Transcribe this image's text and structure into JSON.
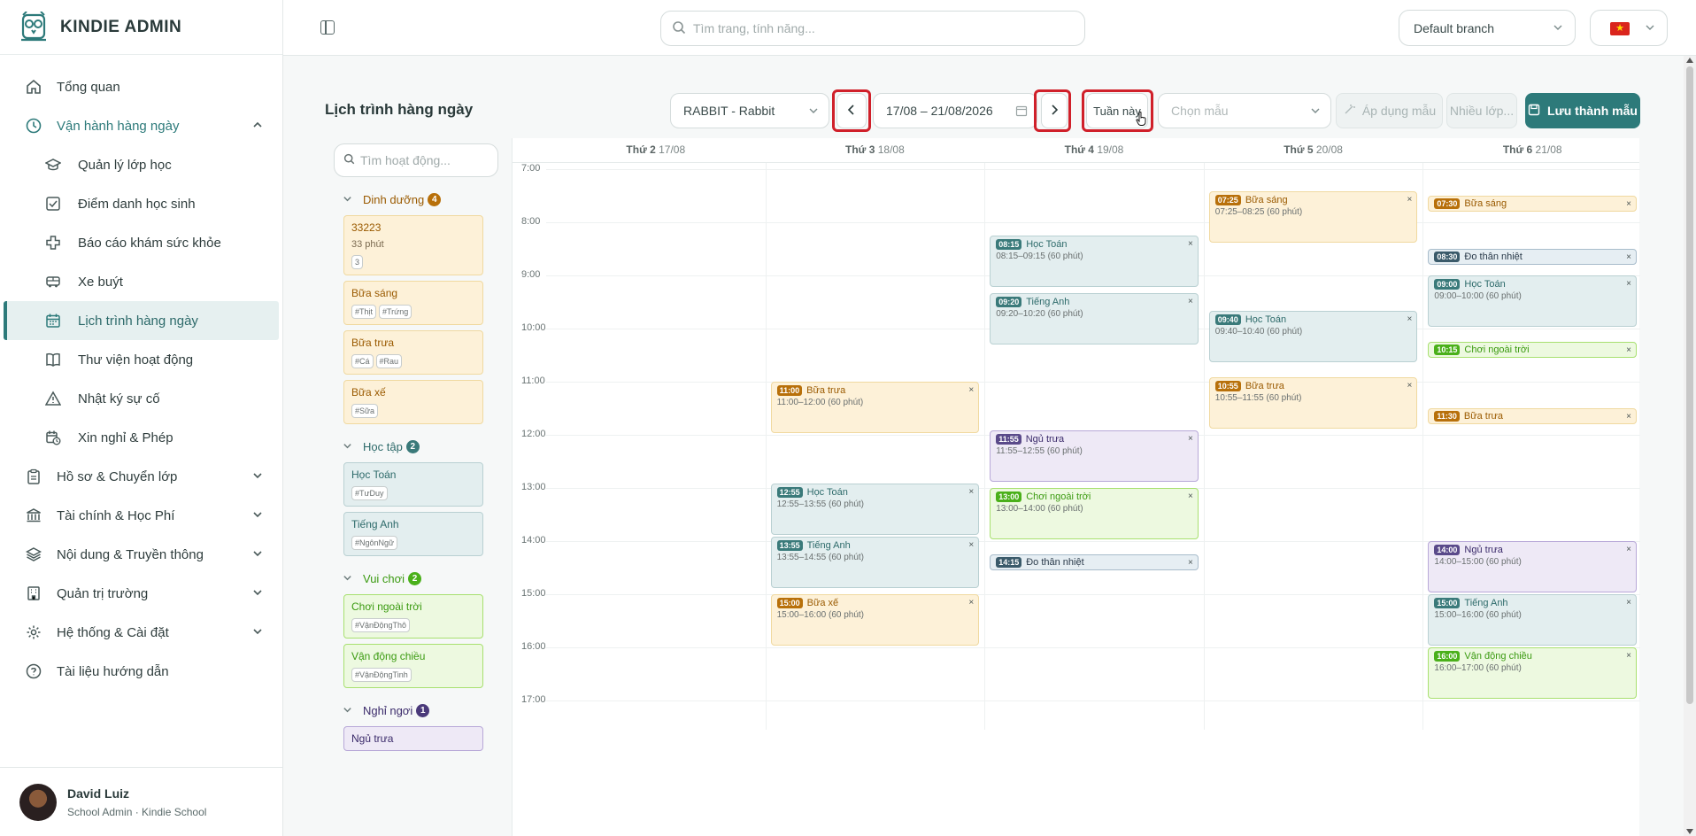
{
  "app": {
    "name": "KINDIE ADMIN"
  },
  "sidebar": {
    "items": [
      {
        "label": "Tổng quan",
        "icon": "home-icon"
      },
      {
        "label": "Vận hành hàng ngày",
        "icon": "clock-icon"
      },
      {
        "label": "Quản lý lớp học",
        "icon": "graduation-cap-icon"
      },
      {
        "label": "Điểm danh học sinh",
        "icon": "checkbox-icon"
      },
      {
        "label": "Báo cáo khám sức khỏe",
        "icon": "health-cross-icon"
      },
      {
        "label": "Xe buýt",
        "icon": "bus-icon"
      },
      {
        "label": "Lịch trình hàng ngày",
        "icon": "calendar-icon"
      },
      {
        "label": "Thư viện hoạt động",
        "icon": "book-icon"
      },
      {
        "label": "Nhật ký sự cố",
        "icon": "warning-icon"
      },
      {
        "label": "Xin nghỉ & Phép",
        "icon": "calendar-clock-icon"
      },
      {
        "label": "Hồ sơ & Chuyển lớp",
        "icon": "clipboard-icon"
      },
      {
        "label": "Tài chính & Học Phí",
        "icon": "bank-icon"
      },
      {
        "label": "Nội dung & Truyền thông",
        "icon": "layers-icon"
      },
      {
        "label": "Quản trị trường",
        "icon": "building-icon"
      },
      {
        "label": "Hệ thống & Cài đặt",
        "icon": "gear-icon"
      },
      {
        "label": "Tài liệu hướng dẫn",
        "icon": "help-icon"
      }
    ]
  },
  "user": {
    "name": "David Luiz",
    "role": "School Admin · Kindie School"
  },
  "topbar": {
    "search_placeholder": "Tìm trang, tính năng...",
    "branch": "Default branch"
  },
  "toolbar": {
    "title": "Lịch trình hàng ngày",
    "class_select": "RABBIT - Rabbit",
    "date_range": "17/08 – 21/08/2026",
    "this_week": "Tuần này",
    "template_placeholder": "Chọn mẫu",
    "apply_template": "Áp dụng mẫu",
    "multi_class": "Nhiều lớp...",
    "save_template": "Lưu thành mẫu"
  },
  "library": {
    "search_placeholder": "Tìm hoạt động...",
    "groups": [
      {
        "name": "Dinh dưỡng",
        "count": "4",
        "color": "#b8700a",
        "items": [
          {
            "title": "33223",
            "sub": "33 phút",
            "tags": [
              "3"
            ]
          },
          {
            "title": "Bữa sáng",
            "tags": [
              "#Thịt",
              "#Trứng"
            ]
          },
          {
            "title": "Bữa trưa",
            "tags": [
              "#Cá",
              "#Rau"
            ]
          },
          {
            "title": "Bữa xế",
            "tags": [
              "#Sữa"
            ]
          }
        ]
      },
      {
        "name": "Học tập",
        "count": "2",
        "color": "#3a7a7a",
        "items": [
          {
            "title": "Học Toán",
            "tags": [
              "#TưDuy"
            ]
          },
          {
            "title": "Tiếng Anh",
            "tags": [
              "#NgônNgữ"
            ]
          }
        ]
      },
      {
        "name": "Vui chơi",
        "count": "2",
        "color": "#4ab01a",
        "items": [
          {
            "title": "Chơi ngoài trời",
            "tags": [
              "#VậnĐộngThô"
            ]
          },
          {
            "title": "Vận động chiều",
            "tags": [
              "#VậnĐộngTinh"
            ]
          }
        ]
      },
      {
        "name": "Nghỉ ngơi",
        "count": "1",
        "color": "#4a3a7a",
        "items": [
          {
            "title": "Ngủ trưa",
            "tags": []
          }
        ]
      }
    ]
  },
  "calendar": {
    "days": [
      {
        "name": "Thứ 2",
        "date": "17/08"
      },
      {
        "name": "Thứ 3",
        "date": "18/08"
      },
      {
        "name": "Thứ 4",
        "date": "19/08"
      },
      {
        "name": "Thứ 5",
        "date": "20/08"
      },
      {
        "name": "Thứ 6",
        "date": "21/08"
      }
    ],
    "hours": [
      "7:00",
      "8:00",
      "9:00",
      "10:00",
      "11:00",
      "12:00",
      "13:00",
      "14:00",
      "15:00",
      "16:00",
      "17:00"
    ],
    "events": [
      {
        "day": 1,
        "start": "11:00",
        "name": "Bữa trưa",
        "range": "11:00–12:00 (60 phút)",
        "color": "orange"
      },
      {
        "day": 1,
        "start": "12:55",
        "name": "Học Toán",
        "range": "12:55–13:55 (60 phút)",
        "color": "teal"
      },
      {
        "day": 1,
        "start": "13:55",
        "name": "Tiếng Anh",
        "range": "13:55–14:55 (60 phút)",
        "color": "teal"
      },
      {
        "day": 1,
        "start": "15:00",
        "name": "Bữa xế",
        "range": "15:00–16:00 (60 phút)",
        "color": "orange"
      },
      {
        "day": 2,
        "start": "08:15",
        "name": "Học Toán",
        "range": "08:15–09:15 (60 phút)",
        "color": "teal"
      },
      {
        "day": 2,
        "start": "09:20",
        "name": "Tiếng Anh",
        "range": "09:20–10:20 (60 phút)",
        "color": "teal"
      },
      {
        "day": 2,
        "start": "11:55",
        "name": "Ngủ trưa",
        "range": "11:55–12:55 (60 phút)",
        "color": "purple"
      },
      {
        "day": 2,
        "start": "13:00",
        "name": "Chơi ngoài trời",
        "range": "13:00–14:00 (60 phút)",
        "color": "green"
      },
      {
        "day": 2,
        "start": "14:15",
        "name": "Đo thân nhiệt",
        "range": "",
        "color": "slate"
      },
      {
        "day": 3,
        "start": "07:25",
        "name": "Bữa sáng",
        "range": "07:25–08:25 (60 phút)",
        "color": "orange"
      },
      {
        "day": 3,
        "start": "09:40",
        "name": "Học Toán",
        "range": "09:40–10:40 (60 phút)",
        "color": "teal"
      },
      {
        "day": 3,
        "start": "10:55",
        "name": "Bữa trưa",
        "range": "10:55–11:55 (60 phút)",
        "color": "orange"
      },
      {
        "day": 4,
        "start": "07:30",
        "name": "Bữa sáng",
        "range": "",
        "color": "orange"
      },
      {
        "day": 4,
        "start": "08:30",
        "name": "Đo thân nhiệt",
        "range": "",
        "color": "slate"
      },
      {
        "day": 4,
        "start": "09:00",
        "name": "Học Toán",
        "range": "09:00–10:00 (60 phút)",
        "color": "teal"
      },
      {
        "day": 4,
        "start": "10:15",
        "name": "Chơi ngoài trời",
        "range": "",
        "color": "green"
      },
      {
        "day": 4,
        "start": "11:30",
        "name": "Bữa trưa",
        "range": "",
        "color": "orange"
      },
      {
        "day": 4,
        "start": "14:00",
        "name": "Ngủ trưa",
        "range": "14:00–15:00 (60 phút)",
        "color": "purple"
      },
      {
        "day": 4,
        "start": "15:00",
        "name": "Tiếng Anh",
        "range": "15:00–16:00 (60 phút)",
        "color": "teal"
      },
      {
        "day": 4,
        "start": "16:00",
        "name": "Vận động chiều",
        "range": "16:00–17:00 (60 phút)",
        "color": "green"
      }
    ]
  }
}
